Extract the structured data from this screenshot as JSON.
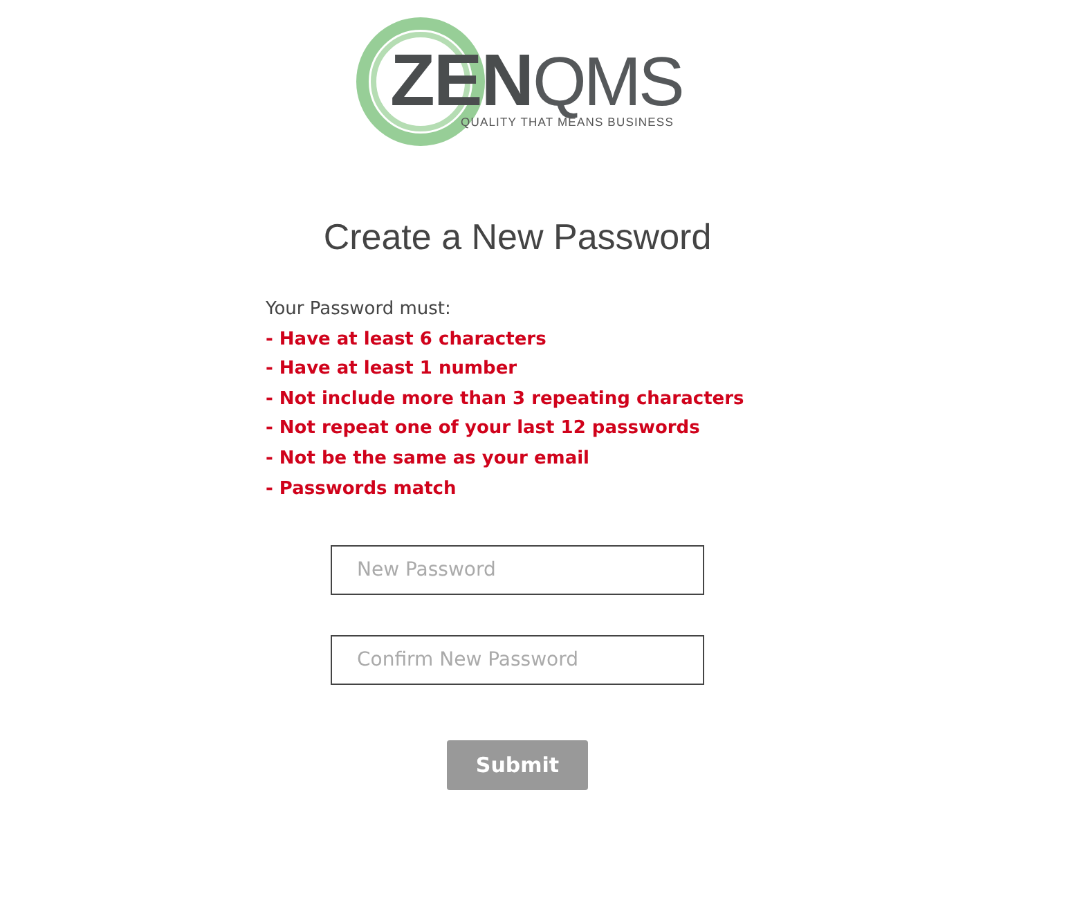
{
  "logo": {
    "brand_bold": "ZEN",
    "brand_light": "QMS",
    "tagline": "QUALITY THAT MEANS BUSINESS"
  },
  "title": "Create a New Password",
  "requirements": {
    "intro": "Your Password must:",
    "rules": [
      {
        "text": "- Have at least 6 characters",
        "met": false
      },
      {
        "text": "- Have at least 1 number",
        "met": false
      },
      {
        "text": "- Not include more than 3 repeating characters",
        "met": false
      },
      {
        "text": "- Not repeat one of your last 12 passwords",
        "met": false
      },
      {
        "text": "- Not be the same as your email",
        "met": false
      },
      {
        "text": "- Passwords match",
        "met": false
      }
    ]
  },
  "fields": [
    {
      "placeholder": "New Password"
    },
    {
      "placeholder": "Confirm New Password"
    }
  ],
  "submit": {
    "label": "Submit",
    "disabled": true
  }
}
